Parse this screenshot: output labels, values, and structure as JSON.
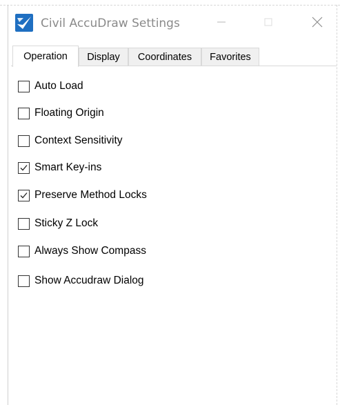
{
  "window": {
    "title": "Civil AccuDraw Settings",
    "icon": "civil-accudraw-app-icon",
    "controls": {
      "minimize_icon": "minimize-icon",
      "maximize_icon": "maximize-icon",
      "close_icon": "close-icon"
    }
  },
  "tabs": [
    {
      "label": "Operation",
      "active": true
    },
    {
      "label": "Display",
      "active": false
    },
    {
      "label": "Coordinates",
      "active": false
    },
    {
      "label": "Favorites",
      "active": false
    }
  ],
  "options": [
    {
      "label": "Auto Load",
      "checked": false
    },
    {
      "label": "Floating Origin",
      "checked": false
    },
    {
      "label": "Context Sensitivity",
      "checked": false
    },
    {
      "label": "Smart Key-ins",
      "checked": true
    },
    {
      "label": "Preserve Method Locks",
      "checked": true
    },
    {
      "label": "Sticky Z Lock",
      "checked": false
    },
    {
      "label": "Always Show Compass",
      "checked": false
    },
    {
      "label": "Show Accudraw Dialog",
      "checked": false
    }
  ],
  "colors": {
    "accent_blue": "#1f6fc1",
    "title_text": "#8a8a8a",
    "border": "#d9d9d9"
  }
}
